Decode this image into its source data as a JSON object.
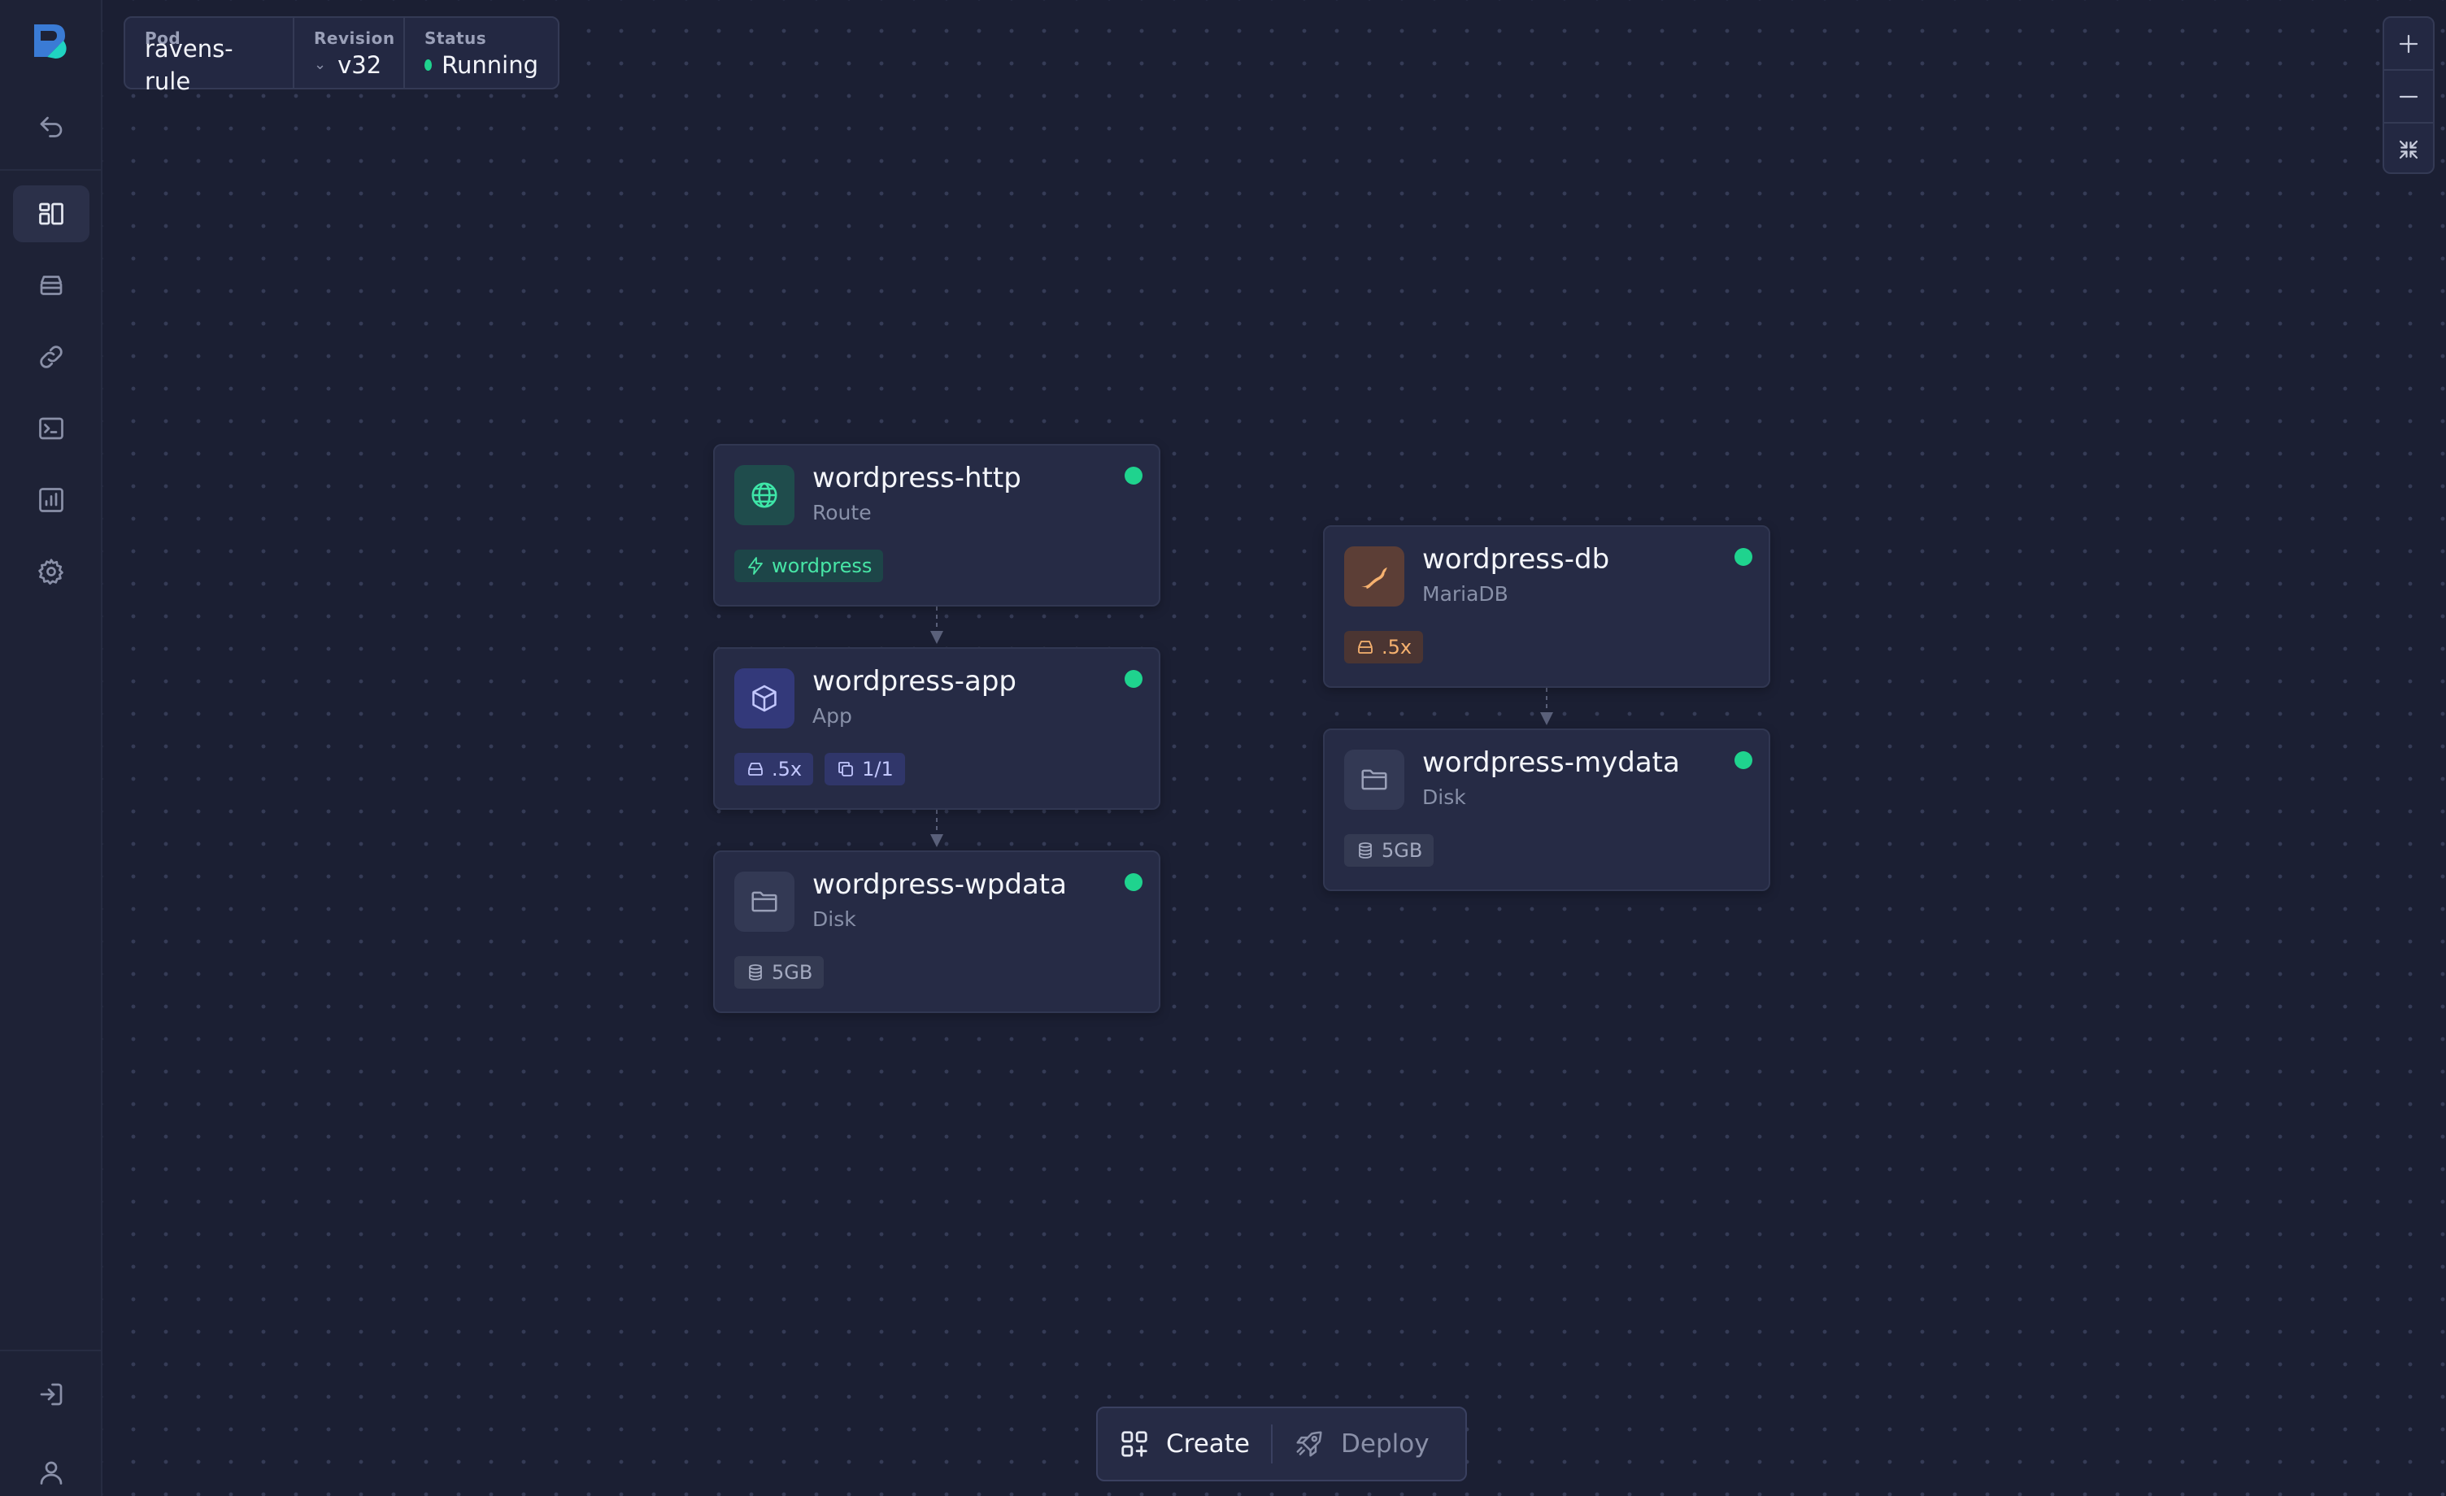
{
  "pod": {
    "pod_label": "Pod",
    "pod_value": "ravens-rule",
    "revision_label": "Revision",
    "revision_value": "v32",
    "status_label": "Status",
    "status_value": "Running",
    "status_color": "#1fd38e"
  },
  "sidebar": {
    "items": [
      {
        "name": "back",
        "icon": "undo-icon"
      },
      {
        "name": "overview",
        "icon": "layout-icon",
        "active": true
      },
      {
        "name": "storage",
        "icon": "database-tray-icon"
      },
      {
        "name": "links",
        "icon": "link-icon"
      },
      {
        "name": "terminal",
        "icon": "terminal-icon"
      },
      {
        "name": "metrics",
        "icon": "bar-chart-icon"
      },
      {
        "name": "settings",
        "icon": "gear-icon"
      }
    ],
    "bottom": [
      {
        "name": "login",
        "icon": "login-icon"
      },
      {
        "name": "account",
        "icon": "user-icon"
      }
    ]
  },
  "zoom": {
    "controls": [
      "zoom-in-icon",
      "zoom-out-icon",
      "fit-view-icon"
    ]
  },
  "nodes": [
    {
      "id": "http",
      "title": "wordpress-http",
      "subtitle": "Route",
      "icon": "globe-icon",
      "status": "running",
      "badges": [
        {
          "icon": "bolt-icon",
          "text": "wordpress",
          "style": "green"
        }
      ]
    },
    {
      "id": "app",
      "title": "wordpress-app",
      "subtitle": "App",
      "icon": "cube-icon",
      "status": "running",
      "badges": [
        {
          "icon": "cpu-tray-icon",
          "text": ".5x",
          "style": "blue"
        },
        {
          "icon": "copy-icon",
          "text": "1/1",
          "style": "blue"
        }
      ]
    },
    {
      "id": "wpdata",
      "title": "wordpress-wpdata",
      "subtitle": "Disk",
      "icon": "folder-icon",
      "status": "running",
      "badges": [
        {
          "icon": "database-icon",
          "text": "5GB",
          "style": "gray"
        }
      ]
    },
    {
      "id": "db",
      "title": "wordpress-db",
      "subtitle": "MariaDB",
      "icon": "mariadb-seal-icon",
      "status": "running",
      "badges": [
        {
          "icon": "cpu-tray-icon",
          "text": ".5x",
          "style": "orange"
        }
      ]
    },
    {
      "id": "mydata",
      "title": "wordpress-mydata",
      "subtitle": "Disk",
      "icon": "folder-icon",
      "status": "running",
      "badges": [
        {
          "icon": "database-icon",
          "text": "5GB",
          "style": "gray"
        }
      ]
    }
  ],
  "toolbar": {
    "create_label": "Create",
    "deploy_label": "Deploy"
  },
  "colors": {
    "accent_green": "#1fd38e",
    "background": "#1b1f33",
    "node_bg": "#262b45"
  }
}
